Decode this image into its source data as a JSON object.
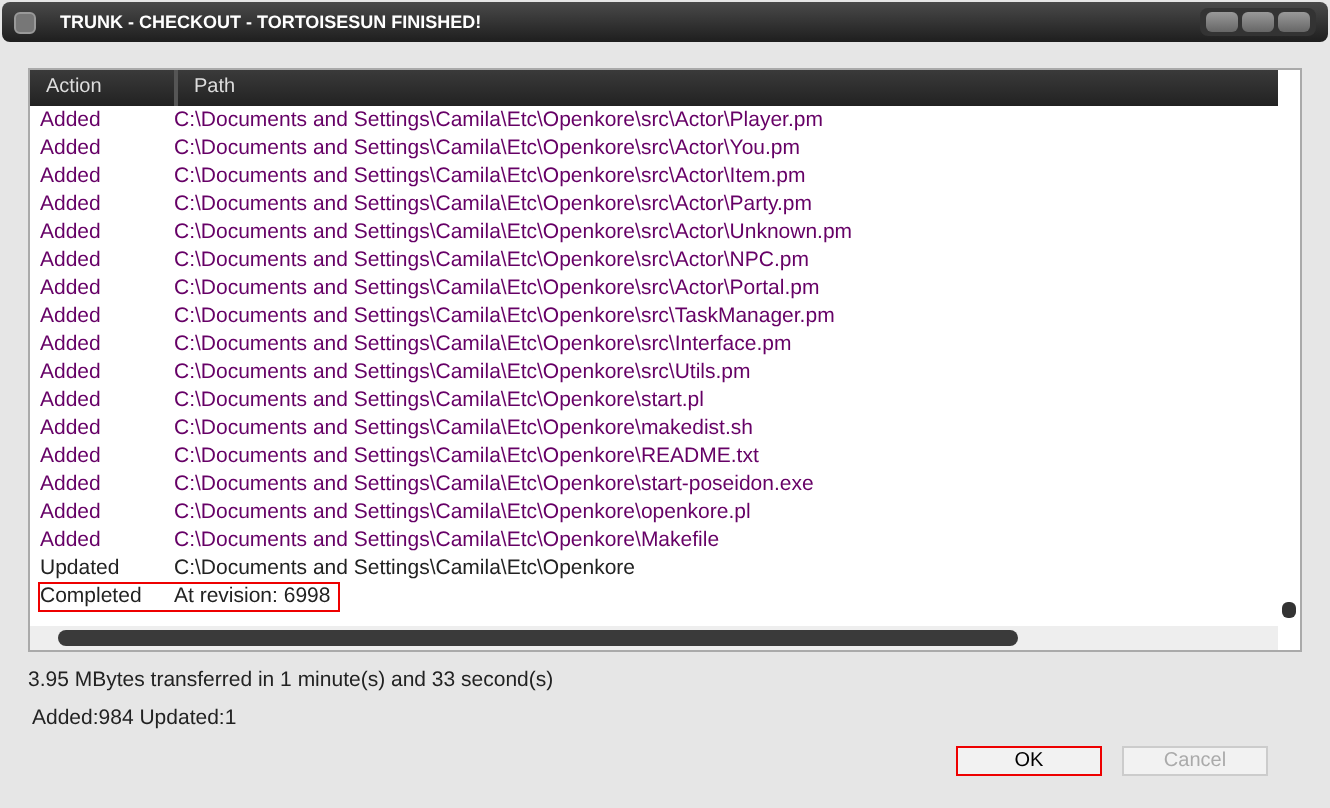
{
  "window": {
    "title": "TRUNK - CHECKOUT - TORTOISESUN FINISHED!"
  },
  "table": {
    "columns": [
      "Action",
      "Path"
    ],
    "rows": [
      {
        "kind": "added",
        "action": "Added",
        "path": "C:\\Documents and Settings\\Camila\\Etc\\Openkore\\src\\Actor\\Player.pm"
      },
      {
        "kind": "added",
        "action": "Added",
        "path": "C:\\Documents and Settings\\Camila\\Etc\\Openkore\\src\\Actor\\You.pm"
      },
      {
        "kind": "added",
        "action": "Added",
        "path": "C:\\Documents and Settings\\Camila\\Etc\\Openkore\\src\\Actor\\Item.pm"
      },
      {
        "kind": "added",
        "action": "Added",
        "path": "C:\\Documents and Settings\\Camila\\Etc\\Openkore\\src\\Actor\\Party.pm"
      },
      {
        "kind": "added",
        "action": "Added",
        "path": "C:\\Documents and Settings\\Camila\\Etc\\Openkore\\src\\Actor\\Unknown.pm"
      },
      {
        "kind": "added",
        "action": "Added",
        "path": "C:\\Documents and Settings\\Camila\\Etc\\Openkore\\src\\Actor\\NPC.pm"
      },
      {
        "kind": "added",
        "action": "Added",
        "path": "C:\\Documents and Settings\\Camila\\Etc\\Openkore\\src\\Actor\\Portal.pm"
      },
      {
        "kind": "added",
        "action": "Added",
        "path": "C:\\Documents and Settings\\Camila\\Etc\\Openkore\\src\\TaskManager.pm"
      },
      {
        "kind": "added",
        "action": "Added",
        "path": "C:\\Documents and Settings\\Camila\\Etc\\Openkore\\src\\Interface.pm"
      },
      {
        "kind": "added",
        "action": "Added",
        "path": "C:\\Documents and Settings\\Camila\\Etc\\Openkore\\src\\Utils.pm"
      },
      {
        "kind": "added",
        "action": "Added",
        "path": "C:\\Documents and Settings\\Camila\\Etc\\Openkore\\start.pl"
      },
      {
        "kind": "added",
        "action": "Added",
        "path": "C:\\Documents and Settings\\Camila\\Etc\\Openkore\\makedist.sh"
      },
      {
        "kind": "added",
        "action": "Added",
        "path": "C:\\Documents and Settings\\Camila\\Etc\\Openkore\\README.txt"
      },
      {
        "kind": "added",
        "action": "Added",
        "path": "C:\\Documents and Settings\\Camila\\Etc\\Openkore\\start-poseidon.exe"
      },
      {
        "kind": "added",
        "action": "Added",
        "path": "C:\\Documents and Settings\\Camila\\Etc\\Openkore\\openkore.pl"
      },
      {
        "kind": "added",
        "action": "Added",
        "path": "C:\\Documents and Settings\\Camila\\Etc\\Openkore\\Makefile"
      },
      {
        "kind": "updated",
        "action": "Updated",
        "path": "C:\\Documents and Settings\\Camila\\Etc\\Openkore"
      },
      {
        "kind": "completed",
        "action": "Completed",
        "path": "At revision: 6998"
      }
    ]
  },
  "transfer": "3.95 MBytes transferred in 1 minute(s) and 33 second(s)",
  "summary": "Added:984 Updated:1",
  "buttons": [
    {
      "label": "OK",
      "disabled": false,
      "focused": true
    },
    {
      "label": "Cancel",
      "disabled": true,
      "focused": false
    }
  ]
}
